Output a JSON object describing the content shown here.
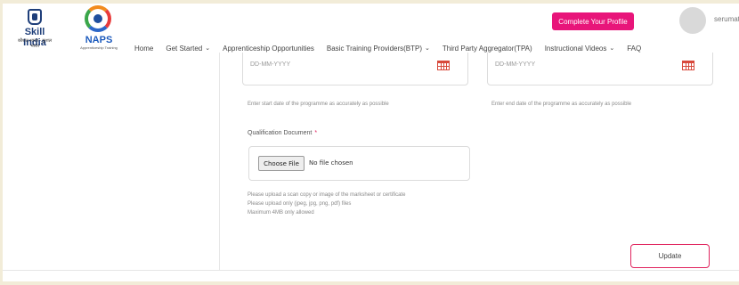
{
  "header": {
    "skill_logo": {
      "title": "Skill India",
      "subtitle": "कौशल भारत - कुशल भारत"
    },
    "naps_logo": {
      "title": "NAPS",
      "subtitle": "Apprenticeship Training"
    },
    "nav": [
      {
        "label": "Home",
        "has_dropdown": false
      },
      {
        "label": "Get Started",
        "has_dropdown": true
      },
      {
        "label": "Apprenticeship Opportunities",
        "has_dropdown": false
      },
      {
        "label": "Basic Training Providers(BTP)",
        "has_dropdown": true
      },
      {
        "label": "Third Party Aggregator(TPA)",
        "has_dropdown": false
      },
      {
        "label": "Instructional Videos",
        "has_dropdown": true
      },
      {
        "label": "FAQ",
        "has_dropdown": false
      }
    ],
    "profile_button": "Complete Your Profile",
    "user_name": "serumat"
  },
  "form": {
    "start_date": {
      "placeholder": "DD-MM-YYYY",
      "hint": "Enter start date of the programme as accurately as possible"
    },
    "end_date": {
      "placeholder": "DD-MM-YYYY",
      "hint": "Enter end date of the programme as accurately as possible"
    },
    "qualification": {
      "label": "Qualification Document",
      "required_mark": "*",
      "choose_button": "Choose File",
      "file_status": "No file chosen",
      "notes": [
        "Please upload a scan copy or image of the marksheet or certificate",
        "Please upload only (jpeg, jpg, png, pdf) files",
        "Maximum 4MB only allowed"
      ]
    },
    "update_button": "Update"
  },
  "colors": {
    "accent": "#e8157a",
    "border_accent": "#e0245e",
    "calendar_icon": "#d84a3c",
    "page_bg": "#f2ecd8"
  }
}
